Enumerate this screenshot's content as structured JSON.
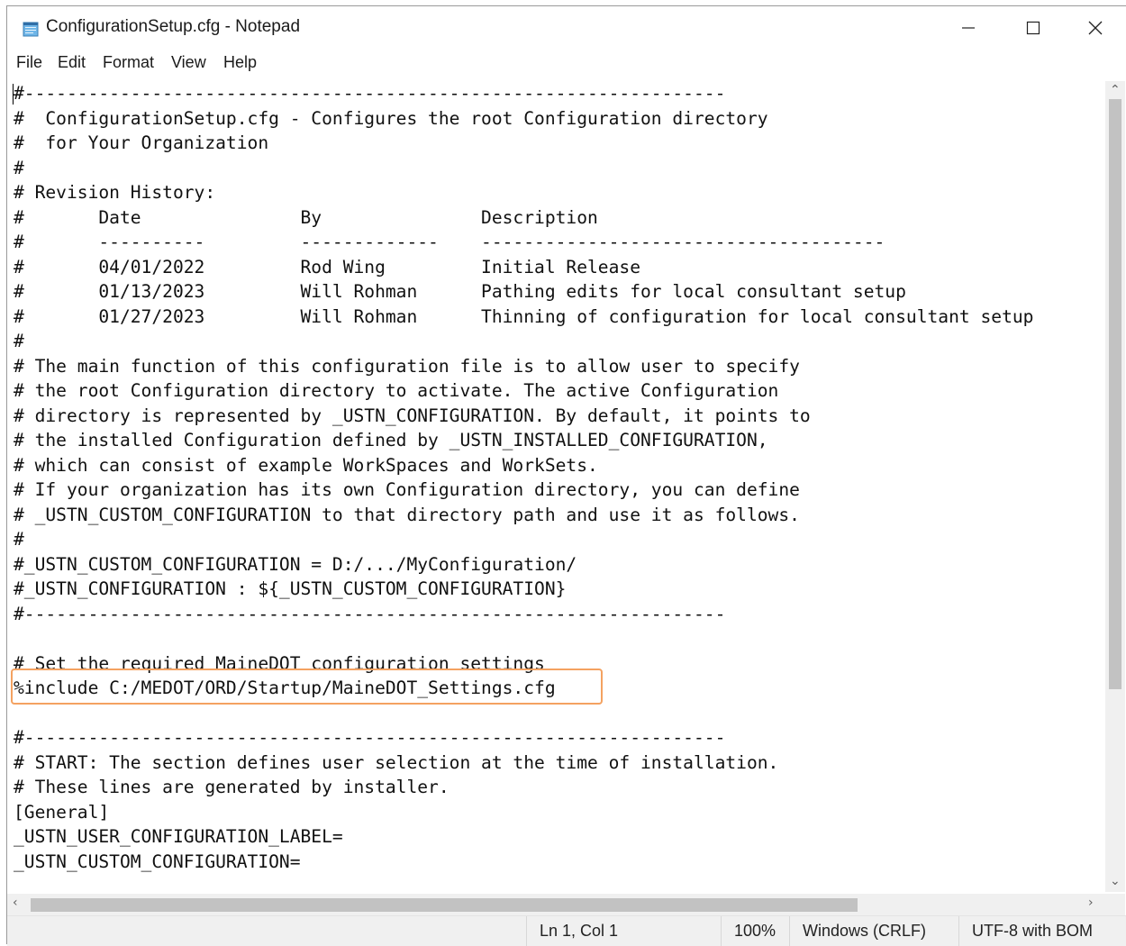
{
  "window": {
    "title": "ConfigurationSetup.cfg - Notepad"
  },
  "menu": [
    "File",
    "Edit",
    "Format",
    "View",
    "Help"
  ],
  "editor": {
    "lines": [
      "#------------------------------------------------------------------",
      "#  ConfigurationSetup.cfg - Configures the root Configuration directory",
      "#  for Your Organization",
      "#",
      "# Revision History:",
      "#       Date               By               Description",
      "#       ----------         -------------    --------------------------------------",
      "#       04/01/2022         Rod Wing         Initial Release",
      "#       01/13/2023         Will Rohman      Pathing edits for local consultant setup",
      "#       01/27/2023         Will Rohman      Thinning of configuration for local consultant setup",
      "#",
      "# The main function of this configuration file is to allow user to specify",
      "# the root Configuration directory to activate. The active Configuration",
      "# directory is represented by _USTN_CONFIGURATION. By default, it points to",
      "# the installed Configuration defined by _USTN_INSTALLED_CONFIGURATION,",
      "# which can consist of example WorkSpaces and WorkSets.",
      "# If your organization has its own Configuration directory, you can define",
      "# _USTN_CUSTOM_CONFIGURATION to that directory path and use it as follows.",
      "#",
      "#_USTN_CUSTOM_CONFIGURATION = D:/.../MyConfiguration/",
      "#_USTN_CONFIGURATION : ${_USTN_CUSTOM_CONFIGURATION}",
      "#------------------------------------------------------------------",
      "",
      "# Set the required MaineDOT configuration settings",
      "%include C:/MEDOT/ORD/Startup/MaineDOT_Settings.cfg",
      "",
      "#------------------------------------------------------------------",
      "# START: The section defines user selection at the time of installation.",
      "# These lines are generated by installer.",
      "[General]",
      "_USTN_USER_CONFIGURATION_LABEL=",
      "_USTN_CUSTOM_CONFIGURATION="
    ]
  },
  "status": {
    "position": "Ln 1, Col 1",
    "zoom": "100%",
    "line_endings": "Windows (CRLF)",
    "encoding": "UTF-8 with BOM"
  },
  "colors": {
    "highlight": "#f4a261"
  },
  "icons": [
    "notepad-icon",
    "minimize-icon",
    "maximize-icon",
    "close-icon",
    "scroll-up-icon",
    "scroll-down-icon",
    "scroll-left-icon",
    "scroll-right-icon"
  ]
}
